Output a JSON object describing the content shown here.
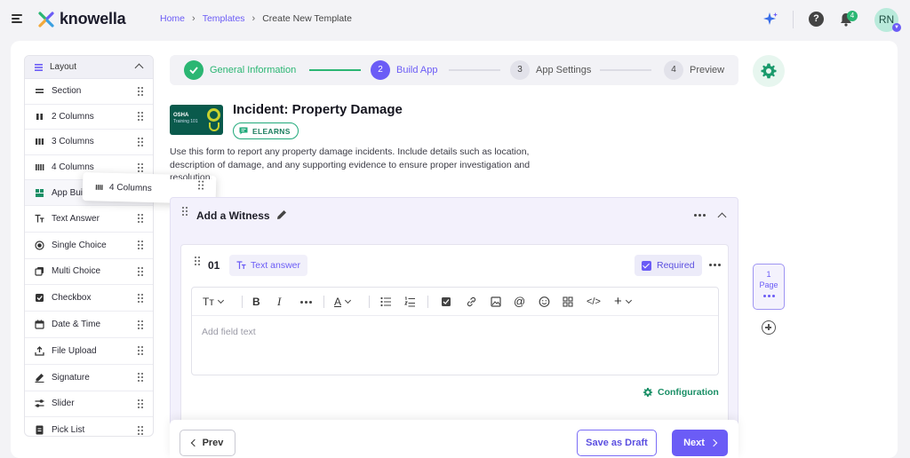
{
  "app": {
    "name": "knowella"
  },
  "breadcrumb": [
    {
      "label": "Home"
    },
    {
      "label": "Templates"
    },
    {
      "label": "Create New Template"
    }
  ],
  "header": {
    "notifications_count": "4",
    "avatar_initials": "RN"
  },
  "sidebar": {
    "header": "Layout",
    "items": [
      {
        "label": "Section",
        "icon": "section-icon"
      },
      {
        "label": "2 Columns",
        "icon": "two-columns-icon"
      },
      {
        "label": "3 Columns",
        "icon": "three-columns-icon"
      },
      {
        "label": "4 Columns",
        "icon": "four-columns-icon"
      },
      {
        "label": "App Builder",
        "icon": "app-builder-icon"
      },
      {
        "label": "Text Answer",
        "icon": "text-answer-icon"
      },
      {
        "label": "Single Choice",
        "icon": "single-choice-icon"
      },
      {
        "label": "Multi Choice",
        "icon": "multi-choice-icon"
      },
      {
        "label": "Checkbox",
        "icon": "checkbox-icon"
      },
      {
        "label": "Date & Time",
        "icon": "calendar-icon"
      },
      {
        "label": "File Upload",
        "icon": "upload-icon"
      },
      {
        "label": "Signature",
        "icon": "signature-icon"
      },
      {
        "label": "Slider",
        "icon": "slider-icon"
      },
      {
        "label": "Pick List",
        "icon": "pick-list-icon"
      }
    ],
    "drag_ghost": "4 Columns"
  },
  "stepper": [
    {
      "num": "",
      "label": "General Information",
      "state": "done"
    },
    {
      "num": "2",
      "label": "Build App",
      "state": "active"
    },
    {
      "num": "3",
      "label": "App Settings",
      "state": "todo"
    },
    {
      "num": "4",
      "label": "Preview",
      "state": "todo"
    }
  ],
  "template": {
    "logo_line1": "OSHA",
    "logo_line2": "Training 101",
    "title": "Incident: Property Damage",
    "badge": "ELEARNS",
    "description": "Use this form to report any property damage incidents. Include details such as location, description of damage, and any supporting evidence to ensure proper investigation and resolution."
  },
  "section": {
    "title": "Add a Witness",
    "field": {
      "number": "01",
      "type": "Text answer",
      "required_label": "Required",
      "placeholder": "Add field text",
      "config_label": "Configuration"
    }
  },
  "page_indicator": {
    "number": "1",
    "label": "Page"
  },
  "footer": {
    "prev": "Prev",
    "draft": "Save as Draft",
    "next": "Next"
  },
  "colors": {
    "accent": "#6b5cf6",
    "success": "#2bb673",
    "brand_dark": "#0a5a4c"
  }
}
